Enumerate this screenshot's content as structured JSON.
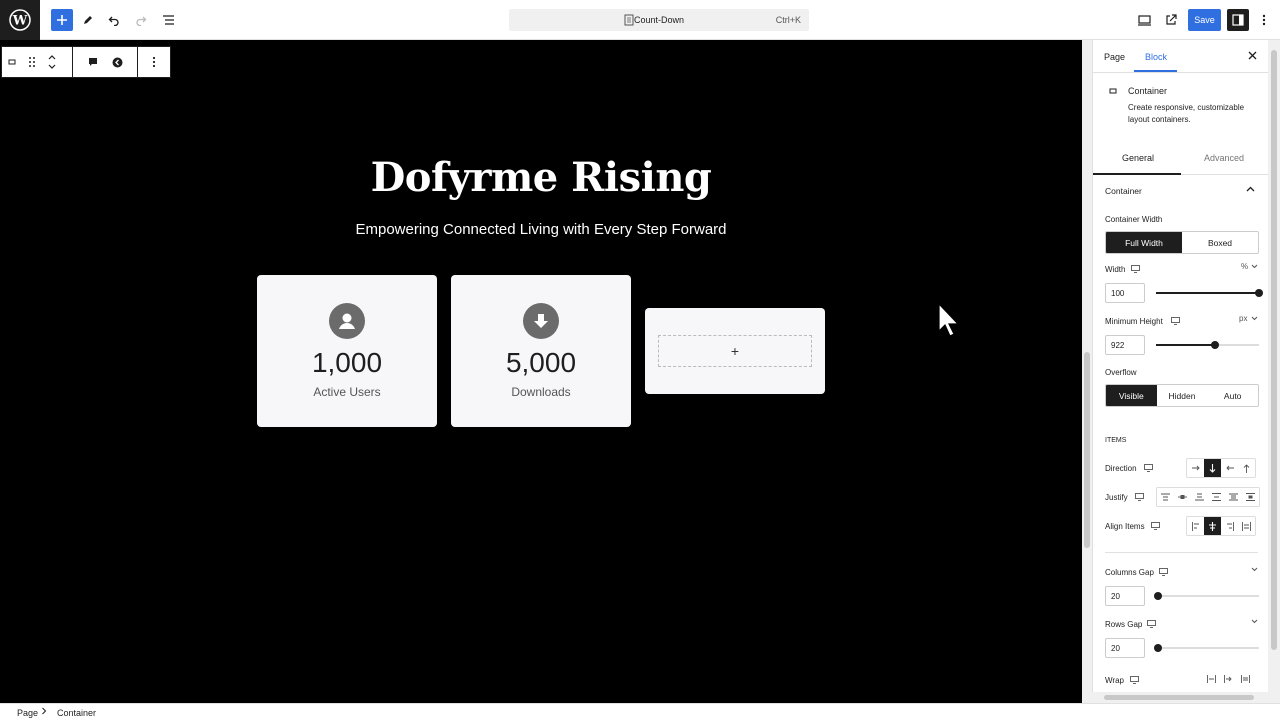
{
  "toolbar": {
    "document_title": "Count-Down",
    "shortcut": "Ctrl+K",
    "save_label": "Save"
  },
  "canvas": {
    "title": "Dofyrme Rising",
    "subtitle": "Empowering Connected Living with Every Step Forward",
    "cards": [
      {
        "value": "1,000",
        "label": "Active Users",
        "icon": "user-icon"
      },
      {
        "value": "5,000",
        "label": "Downloads",
        "icon": "download-icon"
      }
    ],
    "appender_label": "+"
  },
  "breadcrumb": {
    "items": [
      "Page",
      "Container"
    ]
  },
  "sidebar": {
    "tabs": [
      "Page",
      "Block"
    ],
    "active_tab": "Block",
    "block": {
      "name": "Container",
      "description": "Create responsive, customizable layout containers."
    },
    "inner_tabs": [
      "General",
      "Advanced"
    ],
    "panel_title": "Container",
    "container_width": {
      "label": "Container Width",
      "options": [
        "Full Width",
        "Boxed"
      ],
      "selected": "Full Width"
    },
    "width": {
      "label": "Width",
      "value": "100",
      "unit": "%"
    },
    "min_height": {
      "label": "Minimum Height",
      "value": "922",
      "unit": "px"
    },
    "overflow": {
      "label": "Overflow",
      "options": [
        "Visible",
        "Hidden",
        "Auto"
      ],
      "selected": "Visible"
    },
    "items_heading": "ITEMS",
    "direction": {
      "label": "Direction"
    },
    "justify": {
      "label": "Justify"
    },
    "align_items": {
      "label": "Align Items"
    },
    "columns_gap": {
      "label": "Columns Gap",
      "value": "20"
    },
    "rows_gap": {
      "label": "Rows Gap",
      "value": "20"
    },
    "wrap": {
      "label": "Wrap"
    }
  }
}
